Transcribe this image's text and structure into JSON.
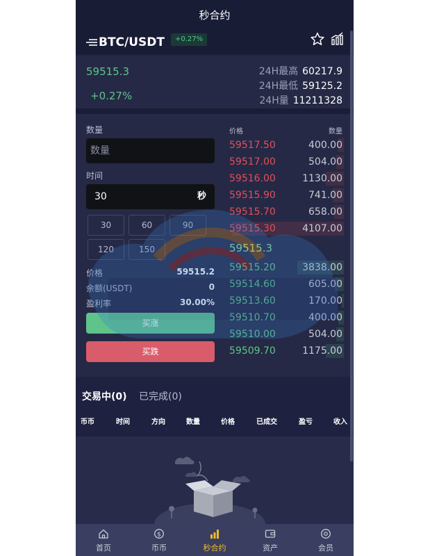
{
  "header": {
    "title": "秒合约"
  },
  "pair": {
    "name": "BTC/USDT",
    "change_badge": "+0.27%"
  },
  "ticker": {
    "price": "59515.3",
    "change": "+0.27%",
    "high_label": "24H最高",
    "high_value": "60217.9",
    "low_label": "24H最低",
    "low_value": "59125.2",
    "volume_label": "24H量",
    "volume_value": "11211328"
  },
  "form": {
    "quantity_label": "数量",
    "quantity_placeholder": "数量",
    "time_label": "时间",
    "time_value": "30",
    "time_unit": "秒",
    "time_options": [
      "30",
      "60",
      "90",
      "120",
      "150"
    ],
    "price_label": "价格",
    "price_value": "59515.2",
    "balance_label": "余额(USDT)",
    "balance_value": "0",
    "profit_label": "盈利率",
    "profit_value": "30.00%",
    "buy_up_label": "买涨",
    "buy_down_label": "买跌"
  },
  "orderbook": {
    "price_header": "价格",
    "qty_header": "数量",
    "asks": [
      {
        "price": "59517.50",
        "qty": "400.00",
        "depth": 0.05
      },
      {
        "price": "59517.00",
        "qty": "504.00",
        "depth": 0.07
      },
      {
        "price": "59516.00",
        "qty": "1130.00",
        "depth": 0.16
      },
      {
        "price": "59515.90",
        "qty": "741.00",
        "depth": 0.1
      },
      {
        "price": "59515.70",
        "qty": "658.00",
        "depth": 0.09
      },
      {
        "price": "59515.30",
        "qty": "4107.00",
        "depth": 1.0
      }
    ],
    "last_price": "59515.3",
    "bids": [
      {
        "price": "59515.20",
        "qty": "3838.00",
        "depth": 0.42
      },
      {
        "price": "59514.60",
        "qty": "605.00",
        "depth": 0.08
      },
      {
        "price": "59513.60",
        "qty": "170.00",
        "depth": 0.02
      },
      {
        "price": "59510.70",
        "qty": "400.00",
        "depth": 0.05
      },
      {
        "price": "59510.00",
        "qty": "504.00",
        "depth": 0.07
      },
      {
        "price": "59509.70",
        "qty": "1175.00",
        "depth": 0.16
      }
    ]
  },
  "orders": {
    "tab_active": "交易中(0)",
    "tab_done": "已完成(0)",
    "columns": [
      "币币",
      "时间",
      "方向",
      "数量",
      "价格",
      "已成交",
      "盈亏",
      "收入"
    ]
  },
  "nav": {
    "items": [
      {
        "label": "首页",
        "icon": "home-icon"
      },
      {
        "label": "币币",
        "icon": "coin-icon"
      },
      {
        "label": "秒合约",
        "icon": "bars-icon"
      },
      {
        "label": "资产",
        "icon": "wallet-icon"
      },
      {
        "label": "会员",
        "icon": "member-icon"
      }
    ],
    "active_index": 2
  },
  "colors": {
    "up": "#5fc58a",
    "down": "#e0505c",
    "accent": "#f2b928",
    "background": "#1e2240"
  }
}
